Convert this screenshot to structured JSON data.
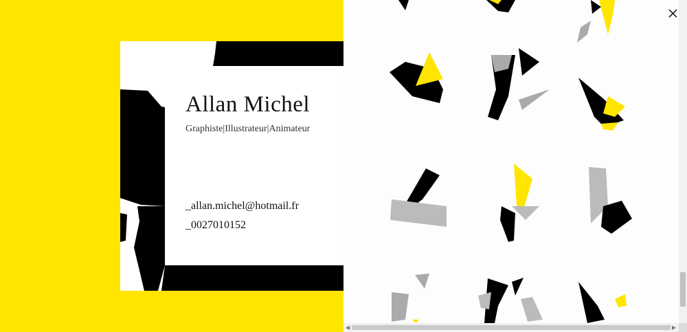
{
  "card": {
    "name": "Allan Michel",
    "roles": "Graphiste|Illustrateur|Animateur",
    "email": "_allan.michel@hotmail.fr",
    "phone": "_0027010152"
  },
  "colors": {
    "brand_yellow": "#ffe500",
    "ink_black": "#000000",
    "paper_white": "#ffffff"
  },
  "controls": {
    "close_icon": "close-icon"
  }
}
